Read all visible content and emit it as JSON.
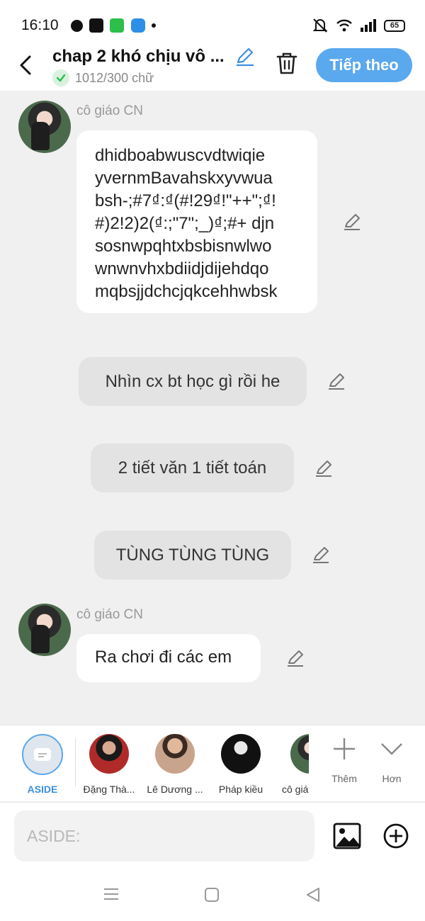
{
  "status_bar": {
    "time": "16:10",
    "battery": "65",
    "apps": [
      "facebook-icon",
      "baomoi-icon",
      "grab-icon",
      "blue-app-icon"
    ]
  },
  "header": {
    "title": "chap 2 khó chịu vô ...",
    "word_count": "1012/300 chữ",
    "next_label": "Tiếp theo"
  },
  "messages": [
    {
      "sender": "cô giáo CN",
      "lines": [
        "dhidboabwuscvdtwiqie",
        "yvernmBavahskxyvwua",
        "bsh-;#7₫:₫(#!29₫!\"++\";₫!",
        "#)2!2)2(₫:;\"7\";_)₫;#+ djn",
        "sosnwpqhtxbsbisnwlwo",
        "wnwnvhxbdiidjdijehdqo",
        "mqbsjjdchcjqkcehhwbsk"
      ]
    },
    {
      "text": "Nhìn cx bt học gì rồi he"
    },
    {
      "text": "2 tiết văn 1 tiết toán"
    },
    {
      "text": "TÙNG TÙNG TÙNG"
    },
    {
      "sender": "cô giáo CN",
      "text": "Ra chơi đi các em"
    }
  ],
  "characters": [
    {
      "name": "ASIDE"
    },
    {
      "name": "Đặng Thà..."
    },
    {
      "name": "Lê Dương ..."
    },
    {
      "name": "Pháp kiều"
    },
    {
      "name": "cô giá"
    }
  ],
  "actions": {
    "more": "Thêm",
    "expand": "Hơn"
  },
  "input": {
    "placeholder": "ASIDE:"
  },
  "colors": {
    "accent": "#5aa8ee",
    "narration_bubble": "#e3e3e3"
  }
}
